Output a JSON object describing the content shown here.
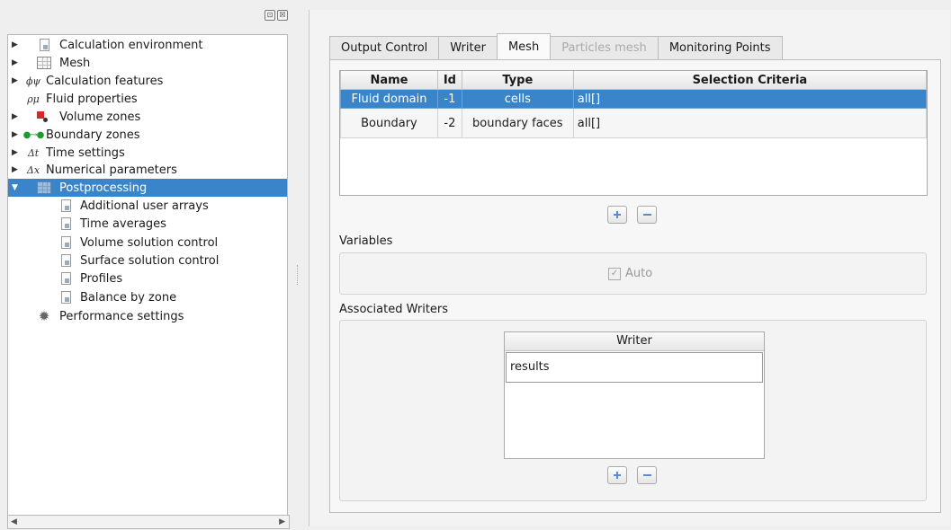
{
  "tree": {
    "items": [
      {
        "label": "Calculation environment",
        "icon": "document-icon",
        "arrow": "▶"
      },
      {
        "label": "Mesh",
        "icon": "grid-icon",
        "arrow": "▶"
      },
      {
        "label": "Calculation features",
        "icon": "ϕψ",
        "arrow": "▶"
      },
      {
        "label": "Fluid properties",
        "icon": "ρμ",
        "arrow": ""
      },
      {
        "label": "Volume zones",
        "icon": "volume-zones-icon",
        "arrow": "▶"
      },
      {
        "label": "Boundary zones",
        "icon": "boundary-zones-icon",
        "arrow": "▶"
      },
      {
        "label": "Time settings",
        "icon": "Δt",
        "arrow": "▶"
      },
      {
        "label": "Numerical parameters",
        "icon": "Δx",
        "arrow": "▶"
      },
      {
        "label": "Postprocessing",
        "icon": "postprocessing-icon",
        "arrow": "▼"
      },
      {
        "label": "Additional user arrays",
        "icon": "document-icon",
        "arrow": ""
      },
      {
        "label": "Time averages",
        "icon": "document-icon",
        "arrow": ""
      },
      {
        "label": "Volume solution control",
        "icon": "document-icon",
        "arrow": ""
      },
      {
        "label": "Surface solution control",
        "icon": "document-icon",
        "arrow": ""
      },
      {
        "label": "Profiles",
        "icon": "document-icon",
        "arrow": ""
      },
      {
        "label": "Balance by zone",
        "icon": "document-icon",
        "arrow": ""
      },
      {
        "label": "Performance settings",
        "icon": "gear-icon",
        "arrow": ""
      }
    ],
    "scroll_left": "◀",
    "scroll_right": "▶",
    "dock_float": "⊡",
    "dock_close": "☒"
  },
  "tabs": [
    {
      "label": "Output Control"
    },
    {
      "label": "Writer"
    },
    {
      "label": "Mesh"
    },
    {
      "label": "Particles mesh"
    },
    {
      "label": "Monitoring Points"
    }
  ],
  "mesh_table": {
    "headers": [
      "Name",
      "Id",
      "Type",
      "Selection Criteria"
    ],
    "rows": [
      [
        "Fluid domain",
        "-1",
        "cells",
        "all[]"
      ],
      [
        "Boundary",
        "-2",
        "boundary faces",
        "all[]"
      ]
    ]
  },
  "variables": {
    "label": "Variables",
    "auto_label": "Auto",
    "check": "✓"
  },
  "associated_writers": {
    "label": "Associated Writers",
    "header": "Writer",
    "rows": [
      "results"
    ]
  },
  "colors": {
    "selection": "#3a85c9",
    "accent_icon": "#5c8ad0"
  }
}
